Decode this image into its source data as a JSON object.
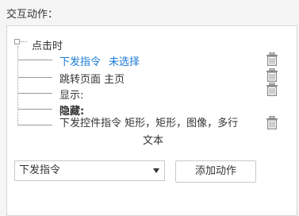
{
  "section_title": "交互动作：",
  "tree": {
    "root_label": "点击时",
    "actions": [
      {
        "label": "下发指令",
        "value": "未选择",
        "link": true,
        "deletable": true
      },
      {
        "label": "跳转页面 主页",
        "value": "",
        "link": false,
        "deletable": true
      },
      {
        "label": "显示:",
        "value": "",
        "link": false,
        "deletable": true
      },
      {
        "label": "隐藏:",
        "value": "",
        "link": false,
        "deletable": false
      },
      {
        "label": "下发控件指令 矩形，矩形，图像，多行",
        "value": "文本",
        "link": false,
        "deletable": true
      }
    ]
  },
  "footer": {
    "select_value": "下发指令",
    "add_button_label": "添加动作"
  },
  "colors": {
    "link": "#1a7bd6",
    "tree_line": "#9a9a9a",
    "icon": "#8c8c8c"
  },
  "icons": {
    "delete": "trash-icon"
  }
}
